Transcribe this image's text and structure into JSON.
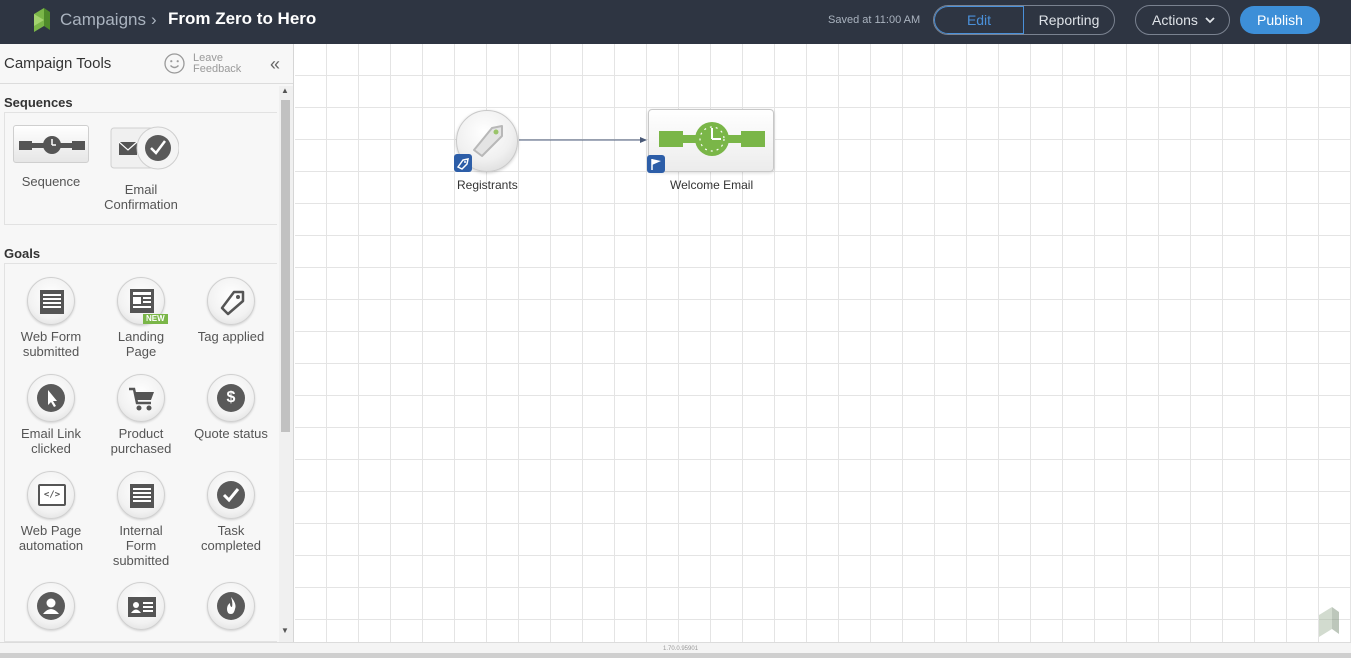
{
  "header": {
    "breadcrumb_root": "Campaigns",
    "breadcrumb_sep": "›",
    "title": "From Zero to Hero",
    "saved_status": "Saved at 11:00 AM",
    "edit_label": "Edit",
    "reporting_label": "Reporting",
    "actions_label": "Actions",
    "publish_label": "Publish",
    "brand_color": "#2e3542",
    "accent_color": "#3d8fd8"
  },
  "sidebar": {
    "title": "Campaign Tools",
    "feedback_line1": "Leave",
    "feedback_line2": "Feedback",
    "collapse_glyph": "«",
    "sequences_label": "Sequences",
    "sequences": [
      {
        "line1": "Sequence",
        "line2": "",
        "icon": "sequence-icon"
      },
      {
        "line1": "Email",
        "line2": "Confirmation",
        "icon": "email-confirmation-icon"
      }
    ],
    "goals_label": "Goals",
    "goals": [
      {
        "line1": "Web Form",
        "line2": "submitted",
        "line3": "",
        "icon": "web-form-icon"
      },
      {
        "line1": "Landing",
        "line2": "Page",
        "line3": "",
        "icon": "landing-page-icon",
        "badge": "NEW"
      },
      {
        "line1": "Tag applied",
        "line2": "",
        "line3": "",
        "icon": "tag-icon"
      },
      {
        "line1": "Email Link",
        "line2": "clicked",
        "line3": "",
        "icon": "cursor-icon"
      },
      {
        "line1": "Product",
        "line2": "purchased",
        "line3": "",
        "icon": "cart-icon"
      },
      {
        "line1": "Quote status",
        "line2": "",
        "line3": "",
        "icon": "dollar-icon",
        "glyph": "$"
      },
      {
        "line1": "Web Page",
        "line2": "automation",
        "line3": "",
        "icon": "code-icon",
        "glyph": "</>"
      },
      {
        "line1": "Internal",
        "line2": "Form",
        "line3": "submitted",
        "icon": "internal-form-icon"
      },
      {
        "line1": "Task",
        "line2": "completed",
        "line3": "",
        "icon": "check-icon"
      },
      {
        "line1": "",
        "line2": "",
        "line3": "",
        "icon": "contact-icon"
      },
      {
        "line1": "",
        "line2": "",
        "line3": "",
        "icon": "card-icon"
      },
      {
        "line1": "",
        "line2": "",
        "line3": "",
        "icon": "fire-icon"
      }
    ]
  },
  "canvas": {
    "nodes": [
      {
        "label": "Registrants",
        "type": "tag-goal"
      },
      {
        "label": "Welcome Email",
        "type": "sequence"
      }
    ]
  },
  "footer": {
    "version": "1.70.0.95901"
  }
}
